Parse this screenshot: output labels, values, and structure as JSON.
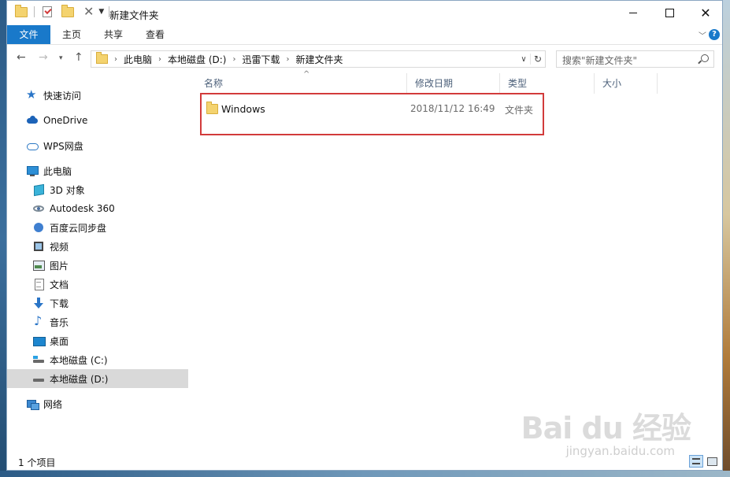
{
  "window": {
    "title": "新建文件夹"
  },
  "ribbon": {
    "tabs": [
      "文件",
      "主页",
      "共享",
      "查看"
    ]
  },
  "address": {
    "crumbs": [
      "此电脑",
      "本地磁盘 (D:)",
      "迅雷下载",
      "新建文件夹"
    ],
    "search_placeholder": "搜索\"新建文件夹\""
  },
  "sidebar": {
    "items": [
      {
        "label": "快速访问"
      },
      {
        "label": "OneDrive"
      },
      {
        "label": "WPS网盘"
      },
      {
        "label": "此电脑"
      },
      {
        "label": "3D 对象"
      },
      {
        "label": "Autodesk 360"
      },
      {
        "label": "百度云同步盘"
      },
      {
        "label": "视频"
      },
      {
        "label": "图片"
      },
      {
        "label": "文档"
      },
      {
        "label": "下载"
      },
      {
        "label": "音乐"
      },
      {
        "label": "桌面"
      },
      {
        "label": "本地磁盘 (C:)"
      },
      {
        "label": "本地磁盘 (D:)"
      },
      {
        "label": "网络"
      }
    ]
  },
  "columns": {
    "name": "名称",
    "date": "修改日期",
    "type": "类型",
    "size": "大小"
  },
  "files": [
    {
      "name": "Windows",
      "date": "2018/11/12 16:49",
      "type": "文件夹"
    }
  ],
  "status": {
    "count": "1 个项目"
  },
  "watermark": {
    "main": "Bai du 经验",
    "sub": "jingyan.baidu.com"
  },
  "colors": {
    "accent": "#1979ca",
    "highlight": "#d23b3b"
  }
}
